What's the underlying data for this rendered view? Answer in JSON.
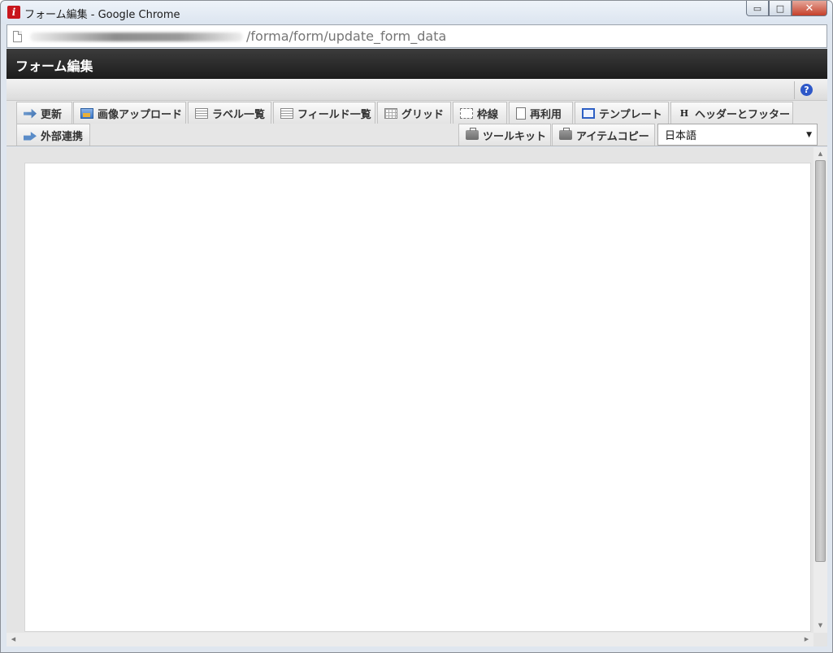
{
  "window": {
    "title": "フォーム編集 - Google Chrome",
    "app_icon_letter": "i",
    "controls": {
      "minimize": "▭",
      "maximize": "□",
      "close": "✕"
    }
  },
  "address_bar": {
    "url_path": "/forma/form/update_form_data"
  },
  "app": {
    "title": "フォーム編集",
    "help_icon": "?"
  },
  "toolbar": {
    "tabs_row1": [
      {
        "label": "更新",
        "icon": "update-icon"
      },
      {
        "label": "画像アップロード",
        "icon": "image-upload-icon"
      },
      {
        "label": "ラベル一覧",
        "icon": "list-icon"
      },
      {
        "label": "フィールド一覧",
        "icon": "list-icon"
      },
      {
        "label": "グリッド",
        "icon": "grid-icon"
      },
      {
        "label": "枠線",
        "icon": "border-icon"
      },
      {
        "label": "再利用",
        "icon": "document-icon"
      },
      {
        "label": "テンプレート",
        "icon": "template-icon"
      },
      {
        "label": "ヘッダーとフッター",
        "icon": "header-icon",
        "icon_text": "H"
      }
    ],
    "tabs_row2": [
      {
        "label": "外部連携",
        "icon": "share-icon"
      },
      {
        "label": "ツールキット",
        "icon": "toolkit-icon"
      },
      {
        "label": "アイテムコピー",
        "icon": "toolkit-icon"
      }
    ],
    "language": {
      "selected": "日本語",
      "arrow": "▼"
    }
  },
  "scrollbars": {
    "up": "▲",
    "down": "▼",
    "left": "◀",
    "right": "▶"
  }
}
